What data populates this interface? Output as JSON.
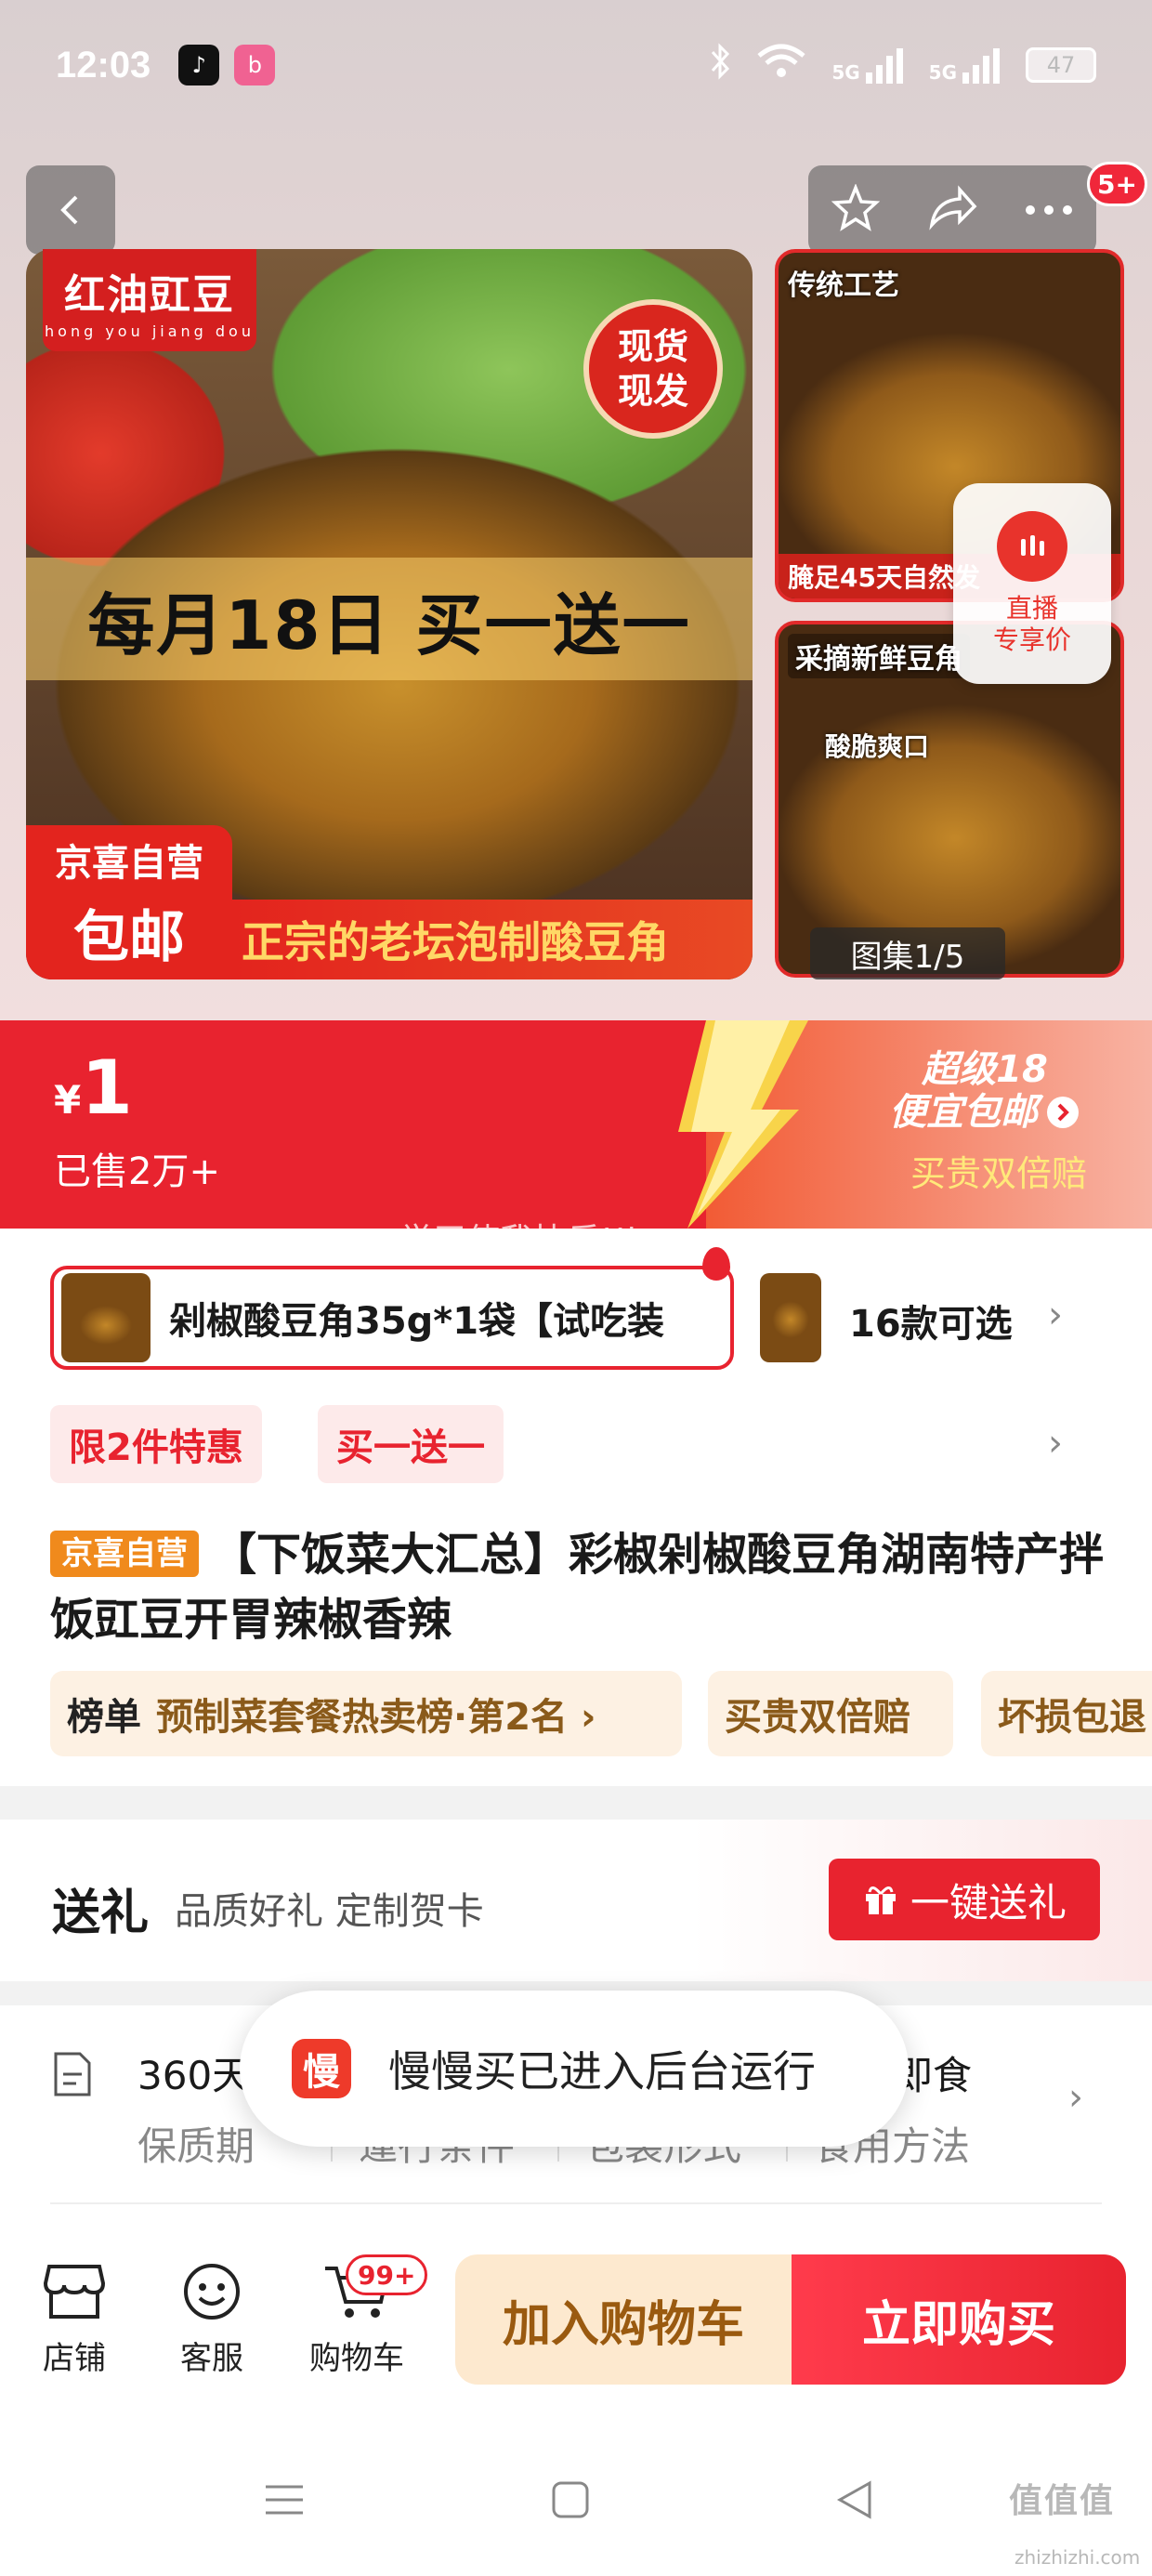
{
  "status_bar": {
    "time": "12:03",
    "battery": "47",
    "signal_1": "5G",
    "signal_2": "5G"
  },
  "header": {
    "badge_count": "5+"
  },
  "gallery": {
    "brand_tag": "红油豇豆",
    "brand_pinyin": "hong you jiang dou",
    "stamp_line1": "现货",
    "stamp_line2": "现发",
    "promo_banner": "每月18日 买一送一",
    "self_op_line1": "京喜自营",
    "self_op_line2": "包邮",
    "slogan": "正宗的老坛泡制酸豆角",
    "thumb1_label": "传统工艺",
    "thumb1_bottom": "腌足45天自然发",
    "thumb2_label": "采摘新鲜豆角",
    "thumb2_sub": "酸脆爽口",
    "counter": "图集1/5",
    "live_line1": "直播",
    "live_line2": "专享价"
  },
  "price": {
    "currency": "¥",
    "value": "1",
    "sold": "已售2万+",
    "super18_line1": "超级18",
    "super18_line2": "便宜包邮",
    "double_pay": "买贵双倍赔"
  },
  "watermark": "学习使我快乐!!k",
  "variant": {
    "selected_name": "剁椒酸豆角35g*1袋【试吃装",
    "count": "16款可选"
  },
  "promo_tags": [
    "限2件特惠",
    "买一送一"
  ],
  "product": {
    "store_tag": "京喜自营",
    "title": "【下饭菜大汇总】彩椒剁椒酸豆角湖南特产拌饭豇豆开胃辣椒香辣"
  },
  "chips": {
    "rank_label": "榜单",
    "rank_value": "预制菜套餐热卖榜·第2名 ›",
    "double_pay": "买贵双倍赔",
    "damage": "坏损包退"
  },
  "gift": {
    "title": "送礼",
    "subtitle": "品质好礼 定制贺卡",
    "button": "一键送礼"
  },
  "attributes": [
    {
      "value": "360天",
      "label": "保质期"
    },
    {
      "value": "",
      "label": "運行条件"
    },
    {
      "value": "",
      "label": "包装形式"
    },
    {
      "value": "即食",
      "label": "食用方法"
    }
  ],
  "toast": {
    "icon_char": "慢",
    "text": "慢慢买已进入后台运行"
  },
  "action_bar": {
    "store": "店铺",
    "service": "客服",
    "cart": "购物车",
    "cart_badge": "99+",
    "add_to_cart": "加入购物车",
    "buy_now": "立即购买"
  },
  "site": {
    "mark": "值值值",
    "sub": "zhizhizhi.com"
  },
  "colors": {
    "accent": "#e8232f",
    "orange_tag": "#f08a1c",
    "cart_bg": "#fde9cf"
  }
}
